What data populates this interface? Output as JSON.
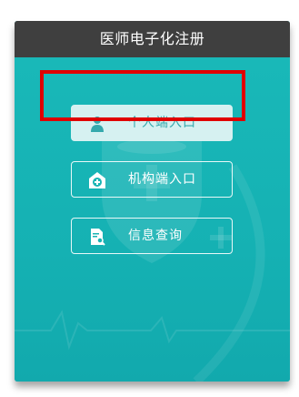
{
  "panel": {
    "title": "医师电子化注册"
  },
  "entries": [
    {
      "label": "个人端入口",
      "icon": "person-icon",
      "state": "selected"
    },
    {
      "label": "机构端入口",
      "icon": "hospital-icon",
      "state": "normal"
    },
    {
      "label": "信息查询",
      "icon": "document-search-icon",
      "state": "normal"
    }
  ],
  "colors": {
    "header": "#3f3f3f",
    "panel": "#19b4b4",
    "selected_button": "#d6f1f1",
    "selected_text": "#35a9ad",
    "highlight": "#e00000"
  }
}
